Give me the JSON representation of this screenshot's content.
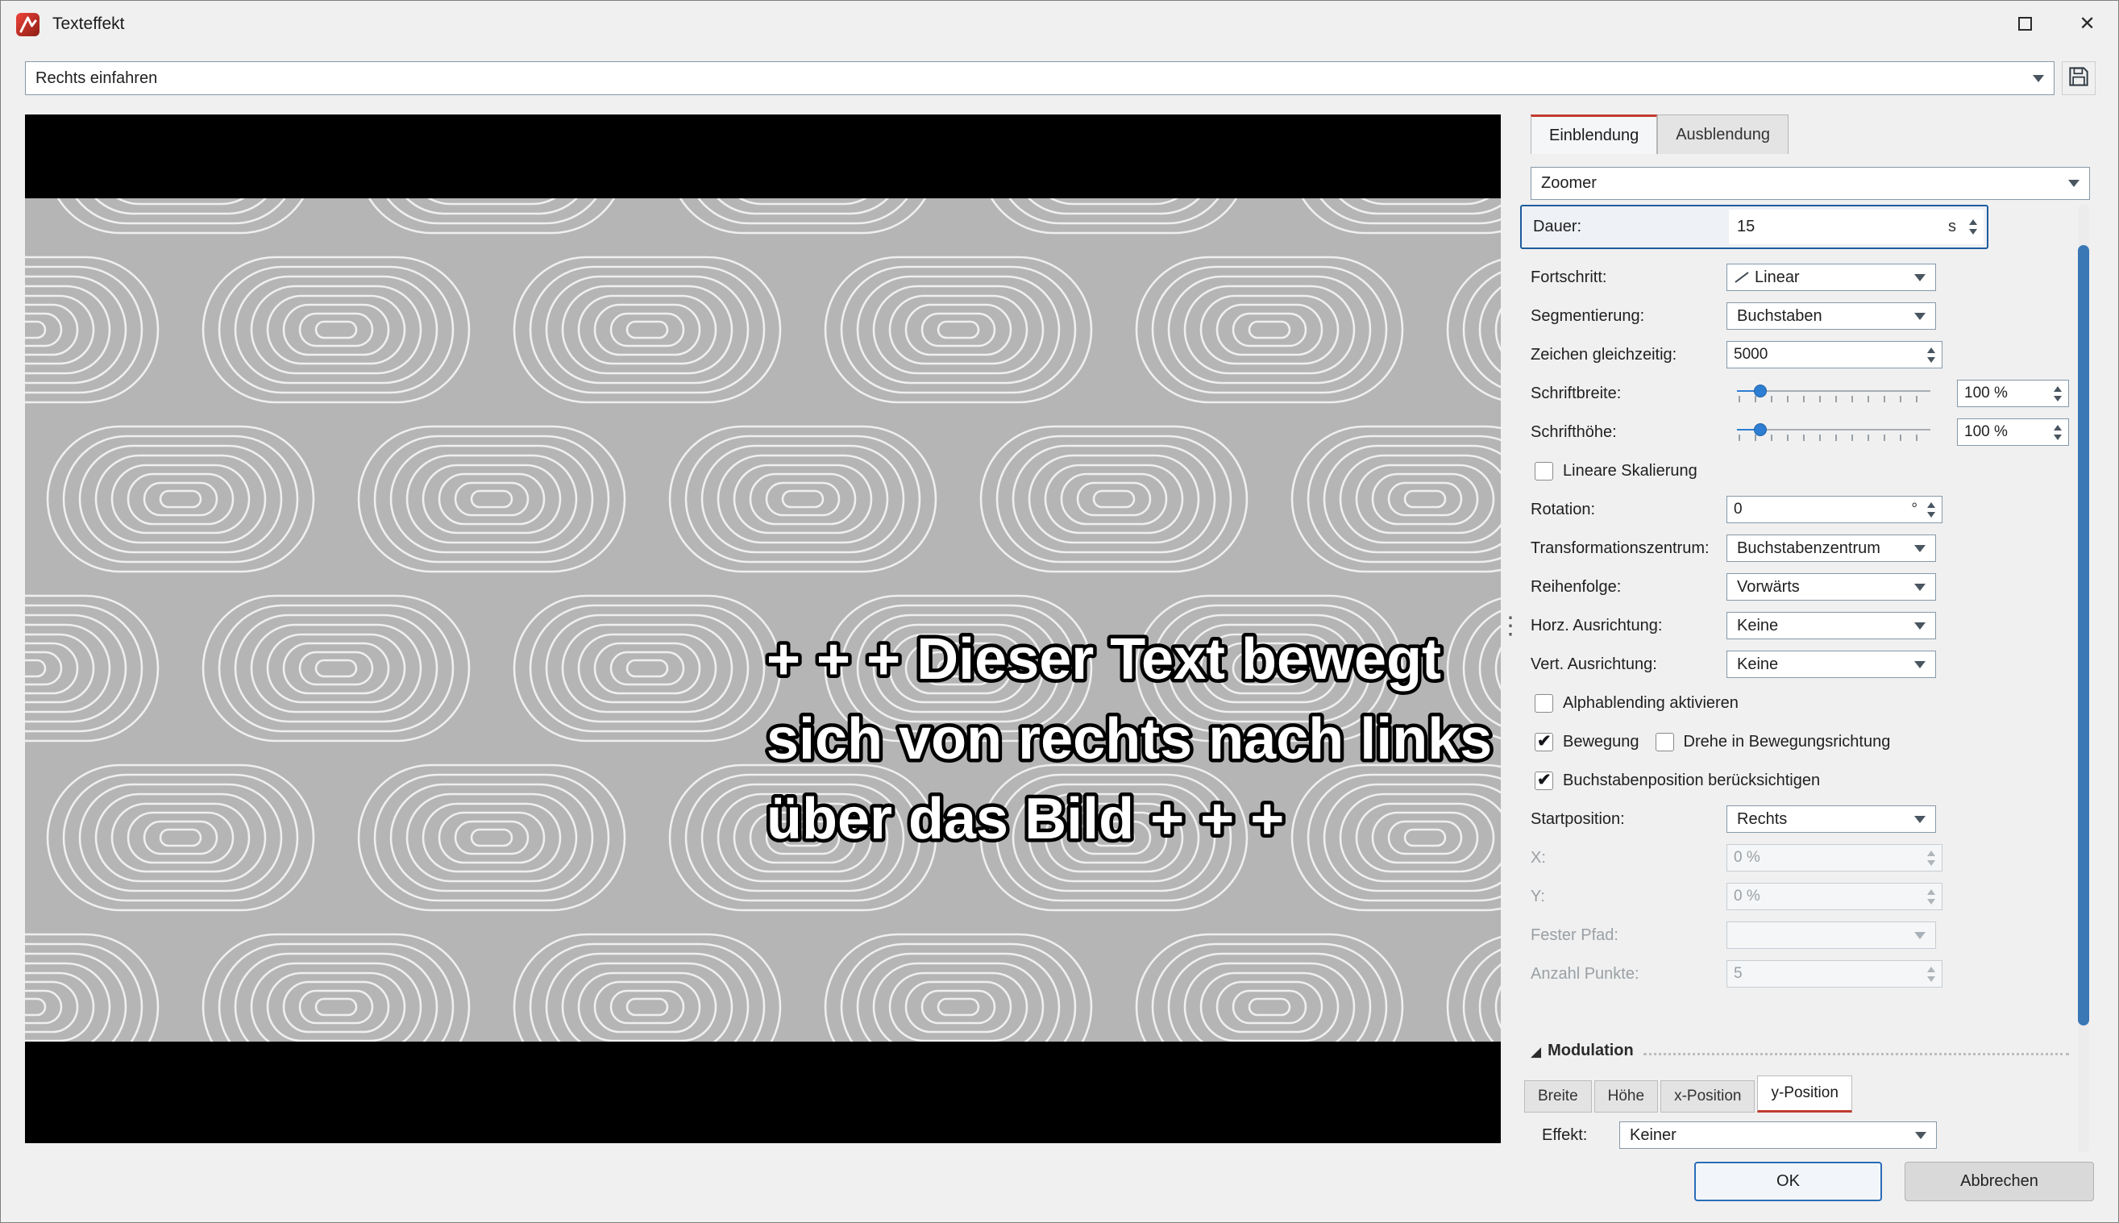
{
  "window": {
    "title": "Texteffekt"
  },
  "toolbar": {
    "preset": "Rechts einfahren"
  },
  "tabs": {
    "einblendung": "Einblendung",
    "ausblendung": "Ausblendung"
  },
  "panel": {
    "effect_type": "Zoomer",
    "dauer": {
      "label": "Dauer:",
      "value": "15",
      "unit": "s"
    },
    "fortschritt": {
      "label": "Fortschritt:",
      "value": "Linear"
    },
    "segmentierung": {
      "label": "Segmentierung:",
      "value": "Buchstaben"
    },
    "zeichen_gleichzeitig": {
      "label": "Zeichen gleichzeitig:",
      "value": "5000"
    },
    "schriftbreite": {
      "label": "Schriftbreite:",
      "value": "100 %",
      "slider_pos": "12%"
    },
    "schrifthoehe": {
      "label": "Schrifthöhe:",
      "value": "100 %",
      "slider_pos": "12%"
    },
    "lineare_skalierung": {
      "label": "Lineare Skalierung",
      "checked": false
    },
    "rotation": {
      "label": "Rotation:",
      "value": "0",
      "unit": "°"
    },
    "transformationszentrum": {
      "label": "Transformationszentrum:",
      "value": "Buchstabenzentrum"
    },
    "reihenfolge": {
      "label": "Reihenfolge:",
      "value": "Vorwärts"
    },
    "horz_ausrichtung": {
      "label": "Horz. Ausrichtung:",
      "value": "Keine"
    },
    "vert_ausrichtung": {
      "label": "Vert. Ausrichtung:",
      "value": "Keine"
    },
    "alphablending": {
      "label": "Alphablending aktivieren",
      "checked": false
    },
    "bewegung": {
      "label": "Bewegung",
      "checked": true
    },
    "drehe": {
      "label": "Drehe in Bewegungsrichtung",
      "checked": false
    },
    "buchstabenposition": {
      "label": "Buchstabenposition berücksichtigen",
      "checked": true
    },
    "startposition": {
      "label": "Startposition:",
      "value": "Rechts"
    },
    "x": {
      "label": "X:",
      "value": "0 %"
    },
    "y": {
      "label": "Y:",
      "value": "0 %"
    },
    "fester_pfad": {
      "label": "Fester Pfad:",
      "value": ""
    },
    "anzahl_punkte": {
      "label": "Anzahl Punkte:",
      "value": "5"
    }
  },
  "modulation": {
    "title": "Modulation",
    "tabs": {
      "breite": "Breite",
      "hoehe": "Höhe",
      "x_position": "x-Position",
      "y_position": "y-Position"
    },
    "effekt": {
      "label": "Effekt:",
      "value": "Keiner"
    }
  },
  "preview": {
    "line1": "+ + + Dieser Text bewegt",
    "line2": "sich von rechts nach links",
    "line3": "über das Bild + + +"
  },
  "buttons": {
    "ok": "OK",
    "cancel": "Abbrechen"
  },
  "colors": {
    "tab_accent": "#c23b2e",
    "focus_border": "#1d5c9e",
    "slider_accent": "#2d7dd2",
    "scrollbar_thumb": "#3a77b5",
    "pattern_background": "#b5b5b5"
  }
}
